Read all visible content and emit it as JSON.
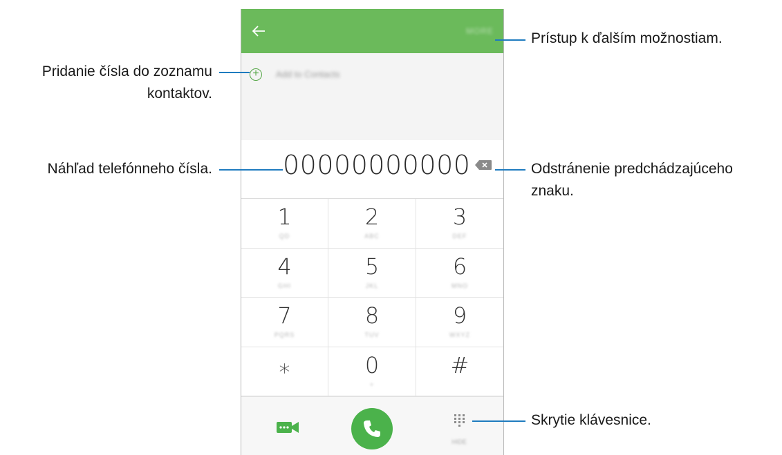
{
  "app_bar": {
    "back_icon": "arrow-left-icon",
    "more_label": "MORE",
    "color": "#6bba5b"
  },
  "add_contact": {
    "icon": "plus-circle-icon",
    "label": "Add to Contacts"
  },
  "number_display": {
    "value": "00000000000",
    "backspace_icon": "backspace-icon"
  },
  "keypad": [
    {
      "digit": "1",
      "letters": "QD"
    },
    {
      "digit": "2",
      "letters": "ABC"
    },
    {
      "digit": "3",
      "letters": "DEF"
    },
    {
      "digit": "4",
      "letters": "GHI"
    },
    {
      "digit": "5",
      "letters": "JKL"
    },
    {
      "digit": "6",
      "letters": "MNO"
    },
    {
      "digit": "7",
      "letters": "PQRS"
    },
    {
      "digit": "8",
      "letters": "TUV"
    },
    {
      "digit": "9",
      "letters": "WXYZ"
    },
    {
      "digit": "⁎",
      "letters": ""
    },
    {
      "digit": "0",
      "letters": "+"
    },
    {
      "digit": "#",
      "letters": ""
    }
  ],
  "bottom_bar": {
    "video_icon": "video-call-icon",
    "call_icon": "phone-icon",
    "hide_icon": "keypad-icon",
    "hide_label": "HIDE",
    "accent": "#4bb24b"
  },
  "callouts": {
    "more_options": "Prístup k ďalším možnostiam.",
    "add_contact_line1": "Pridanie čísla do zoznamu",
    "add_contact_line2": "kontaktov.",
    "preview_number": "Náhľad telefónneho čísla.",
    "delete_line1": "Odstránenie predchádzajúceho",
    "delete_line2": "znaku.",
    "hide_keypad": "Skrytie klávesnice."
  }
}
